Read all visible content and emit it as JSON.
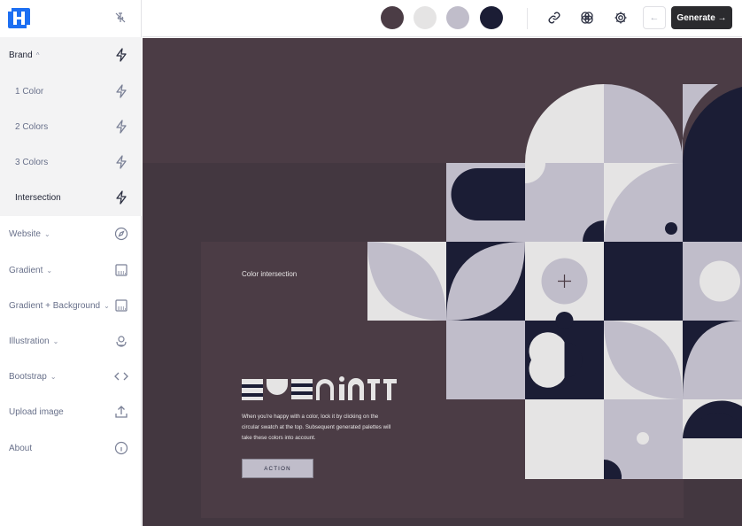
{
  "sidebar": {
    "brand_group": {
      "label": "Brand",
      "chevron": "^",
      "items": [
        {
          "label": "1 Color"
        },
        {
          "label": "2 Colors"
        },
        {
          "label": "3 Colors"
        },
        {
          "label": "Intersection"
        }
      ]
    },
    "nav": [
      {
        "label": "Website",
        "chevron": "⌄",
        "icon": "compass-icon"
      },
      {
        "label": "Gradient",
        "chevron": "⌄",
        "icon": "gradient-icon"
      },
      {
        "label": "Gradient + Background",
        "chevron": "⌄",
        "icon": "gradient-background-icon"
      },
      {
        "label": "Illustration",
        "chevron": "⌄",
        "icon": "illustration-icon"
      },
      {
        "label": "Bootstrap",
        "chevron": "⌄",
        "icon": "code-icon"
      },
      {
        "label": "Upload image",
        "chevron": "",
        "icon": "upload-icon"
      },
      {
        "label": "About",
        "chevron": "",
        "icon": "info-icon"
      }
    ]
  },
  "palette": {
    "swatches": [
      "#4b3c45",
      "#e5e4e4",
      "#c0bdca",
      "#1b1d35"
    ]
  },
  "toolbar": {
    "back_symbol": "←",
    "generate_label": "Generate →"
  },
  "canvas": {
    "card_title": "Color intersection",
    "description": "When you're happy with a color, lock it by clicking on the circular swatch at the top. Subsequent generated palettes will take these colors into account.",
    "action_label": "ACTION"
  },
  "colors": {
    "accent": "#1d6ff2",
    "dark": "#1b1d35",
    "lavender": "#c0bdca",
    "light": "#e5e4e4",
    "mauve": "#4b3c45"
  }
}
